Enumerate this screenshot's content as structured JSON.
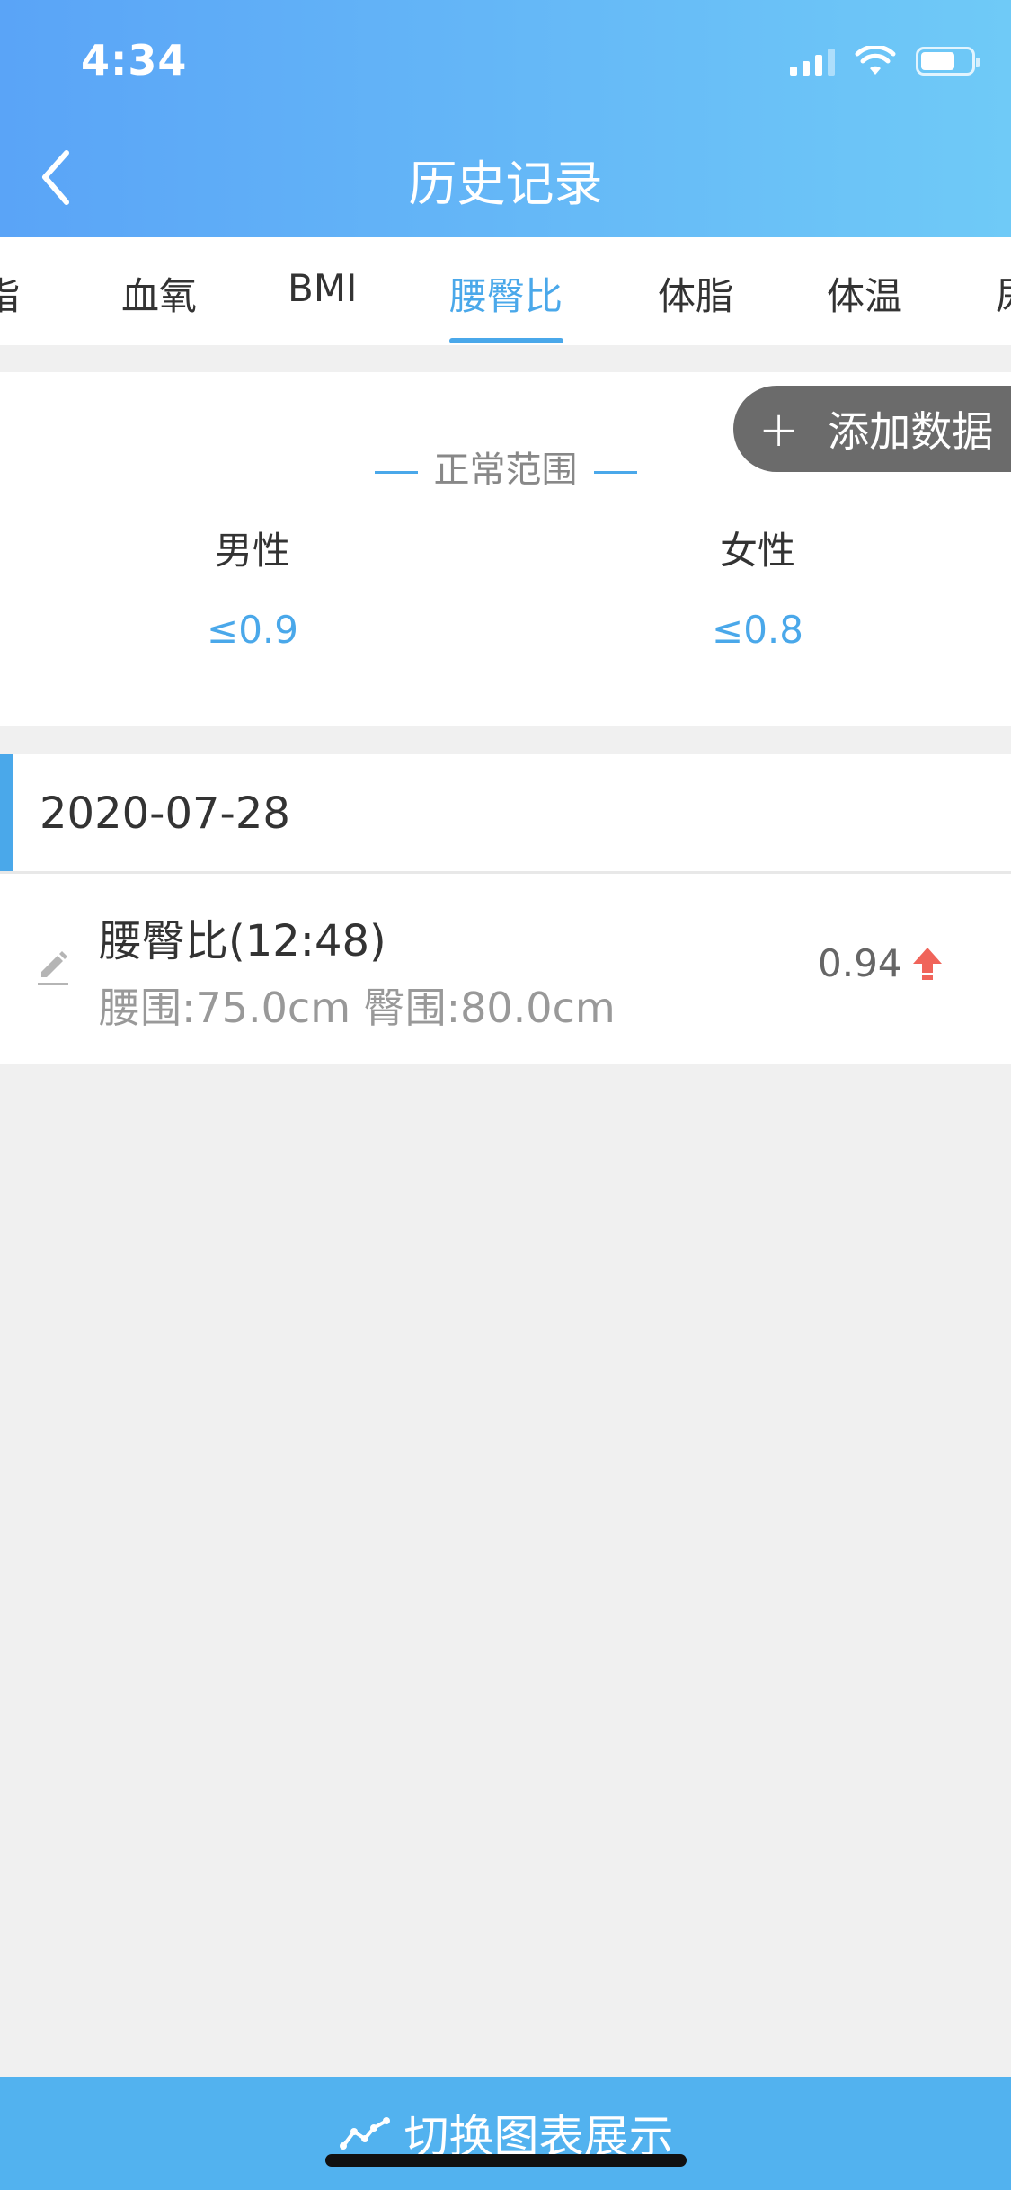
{
  "status_bar": {
    "time": "4:34"
  },
  "header": {
    "title": "历史记录"
  },
  "tabs": [
    {
      "label": "脂",
      "active": false
    },
    {
      "label": "血氧",
      "active": false
    },
    {
      "label": "BMI",
      "active": false
    },
    {
      "label": "腰臀比",
      "active": true
    },
    {
      "label": "体脂",
      "active": false
    },
    {
      "label": "体温",
      "active": false
    },
    {
      "label": "尿",
      "active": false
    }
  ],
  "add_button": {
    "label": "添加数据"
  },
  "normal_range": {
    "title": "正常范围",
    "male": {
      "label": "男性",
      "value": "≤0.9"
    },
    "female": {
      "label": "女性",
      "value": "≤0.8"
    }
  },
  "records": {
    "date": "2020-07-28",
    "items": [
      {
        "title": "腰臀比(12:48)",
        "detail": "腰围:75.0cm 臀围:80.0cm",
        "value": "0.94",
        "trend": "up"
      }
    ]
  },
  "bottom_bar": {
    "label": "切换图表展示"
  },
  "colors": {
    "accent": "#4aa8ea",
    "header_start": "#5aa4f7",
    "header_end": "#6fcaf7",
    "alert": "#f0645a",
    "add_button_bg": "#6b6b6b"
  }
}
